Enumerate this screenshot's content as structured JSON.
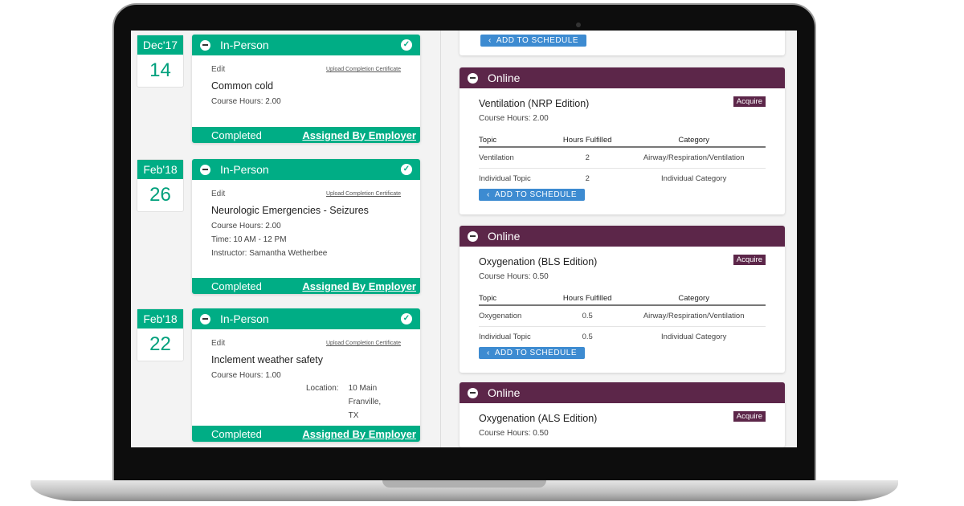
{
  "left": [
    {
      "month": "Dec'17",
      "day": "14",
      "type": "In-Person",
      "edit": "Edit",
      "upload": "Upload Completion Certificate",
      "title": "Common cold",
      "lines": [
        "Course Hours: 2.00"
      ],
      "status": "Completed",
      "assigned": "Assigned By Employer"
    },
    {
      "month": "Feb'18",
      "day": "26",
      "type": "In-Person",
      "edit": "Edit",
      "upload": "Upload Completion Certificate",
      "title": "Neurologic Emergencies - Seizures",
      "lines": [
        "Course Hours: 2.00",
        "Time: 10 AM - 12 PM",
        "Instructor: Samantha Wetherbee"
      ],
      "status": "Completed",
      "assigned": "Assigned By Employer"
    },
    {
      "month": "Feb'18",
      "day": "22",
      "type": "In-Person",
      "edit": "Edit",
      "upload": "Upload Completion Certificate",
      "title": "Inclement weather safety",
      "lines": [
        "Course Hours: 1.00"
      ],
      "location_label": "Location:",
      "location": [
        "10 Main",
        "Franville,",
        "TX"
      ],
      "status": "Completed",
      "assigned": "Assigned By Employer"
    }
  ],
  "add_label": "ADD TO SCHEDULE",
  "table_headers": [
    "Topic",
    "Hours Fulfilled",
    "Category"
  ],
  "right": [
    {
      "type": "Online",
      "title": "Ventilation (NRP Edition)",
      "acquire": "Acquire",
      "hours": "Course Hours: 2.00",
      "rows": [
        [
          "Ventilation",
          "2",
          "Airway/Respiration/Ventilation"
        ],
        [
          "Individual Topic",
          "2",
          "Individual Category"
        ]
      ]
    },
    {
      "type": "Online",
      "title": "Oxygenation (BLS Edition)",
      "acquire": "Acquire",
      "hours": "Course Hours: 0.50",
      "rows": [
        [
          "Oxygenation",
          "0.5",
          "Airway/Respiration/Ventilation"
        ],
        [
          "Individual Topic",
          "0.5",
          "Individual Category"
        ]
      ]
    },
    {
      "type": "Online",
      "title": "Oxygenation (ALS Edition)",
      "acquire": "Acquire",
      "hours": "Course Hours: 0.50"
    }
  ]
}
